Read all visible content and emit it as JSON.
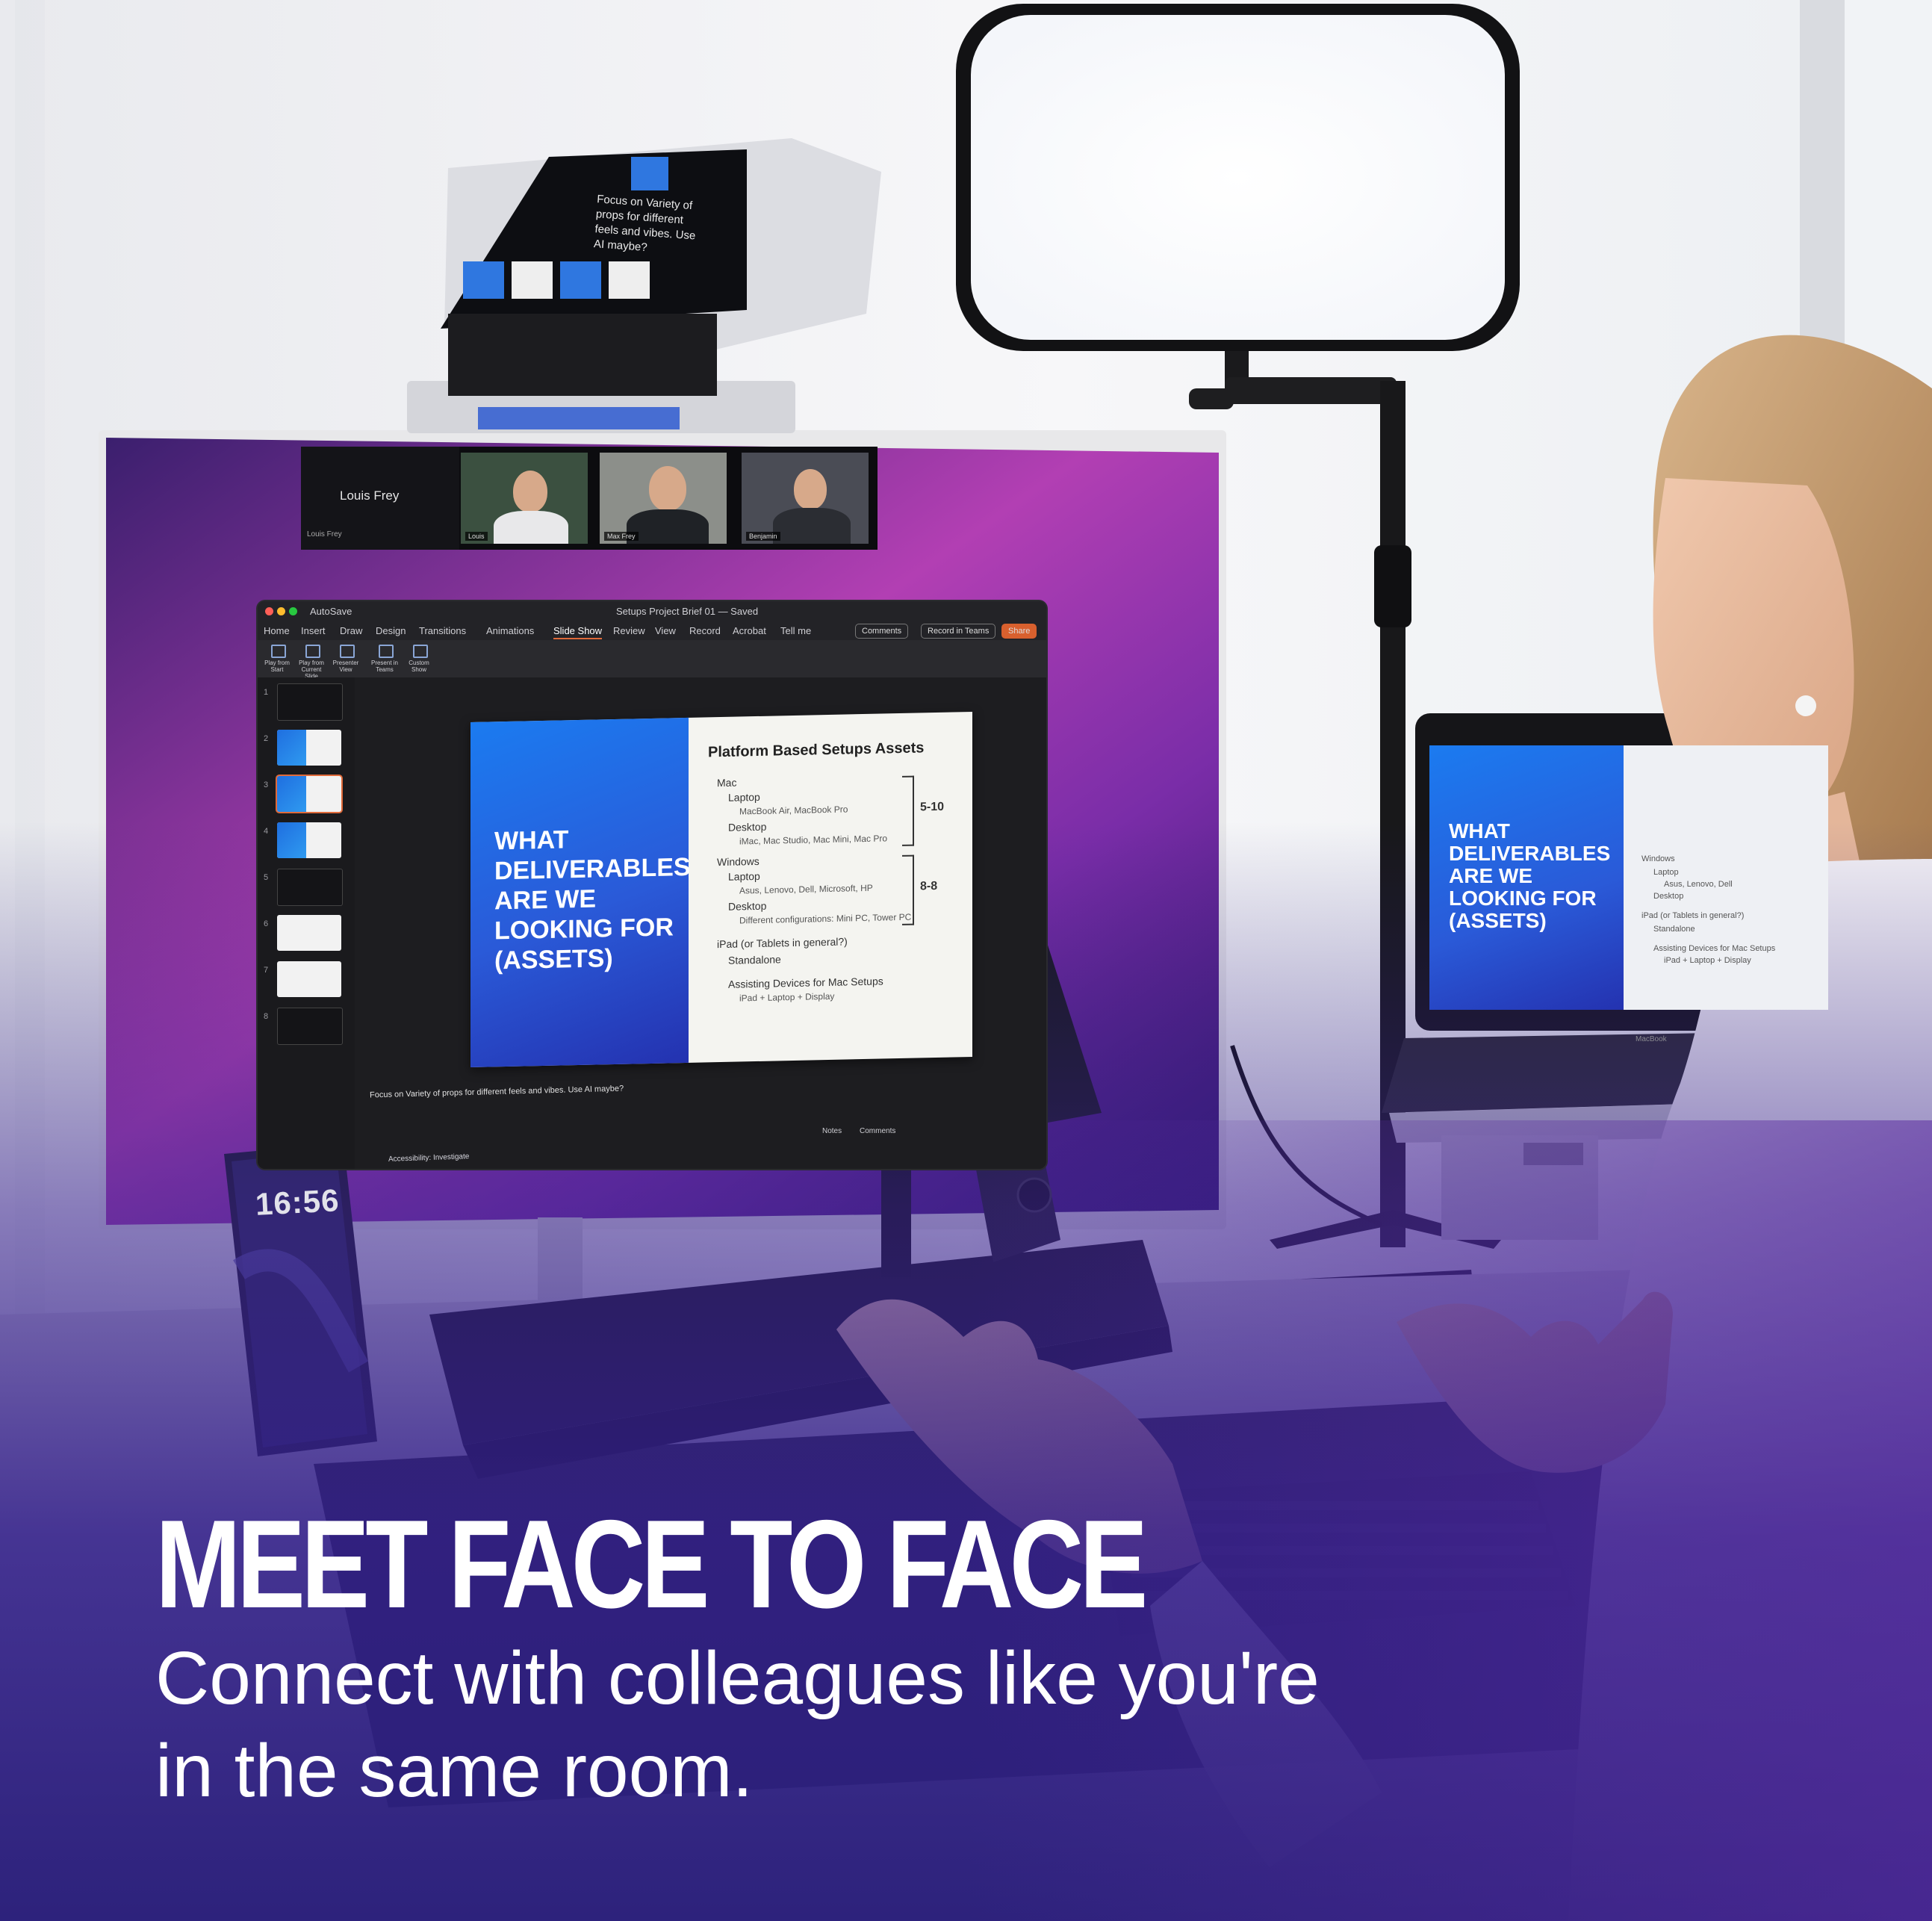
{
  "headline": {
    "title": "MEET FACE TO FACE",
    "subtitle_line1": "Connect with colleagues like you're",
    "subtitle_line2": "in the same room."
  },
  "colors": {
    "overlay_deep": "#2a1f7a",
    "overlay_purple": "#5a2aa0",
    "monitor_magenta": "#b23fb3",
    "slide_blue": "#1f6fe0"
  },
  "teleprompter": {
    "text": "Focus on Variety of props for different feels and vibes. Use AI maybe?"
  },
  "zoom_call": {
    "host_name": "Louis Frey",
    "host_sub": "Louis Frey",
    "participants": [
      "Louis",
      "Max Frey",
      "Benjamin"
    ]
  },
  "powerpoint": {
    "file_title": "Setups Project Brief 01 — Saved",
    "autosave": "AutoSave",
    "tabs": [
      "Home",
      "Insert",
      "Draw",
      "Design",
      "Transitions",
      "Animations",
      "Slide Show",
      "Review",
      "View",
      "Record",
      "Acrobat",
      "Tell me"
    ],
    "active_tab": "Slide Show",
    "buttons": {
      "comments": "Comments",
      "record": "Record in Teams",
      "share": "Share"
    },
    "ribbon": [
      "Play from Start",
      "Play from Current Slide",
      "Presenter View",
      "Present in Teams",
      "Custom Show"
    ],
    "thumb_numbers": [
      "1",
      "2",
      "3",
      "4",
      "5",
      "6",
      "7",
      "8"
    ],
    "notes": "Focus on Variety of props for different feels and vibes. Use AI maybe?",
    "status": [
      "Notes",
      "Comments"
    ],
    "accessibility": "Accessibility: Investigate"
  },
  "slide": {
    "headline": "WHAT DELIVERABLES ARE WE LOOKING FOR (ASSETS)",
    "title": "Platform Based Setups Assets",
    "items": [
      {
        "text": "Mac",
        "level": 0
      },
      {
        "text": "Laptop",
        "level": 1
      },
      {
        "text": "MacBook Air, MacBook Pro",
        "level": 2
      },
      {
        "text": "Desktop",
        "level": 1
      },
      {
        "text": "iMac, Mac Studio, Mac Mini, Mac Pro",
        "level": 2
      },
      {
        "text": "Windows",
        "level": 0
      },
      {
        "text": "Laptop",
        "level": 1
      },
      {
        "text": "Asus, Lenovo, Dell, Microsoft, HP",
        "level": 2
      },
      {
        "text": "Desktop",
        "level": 1
      },
      {
        "text": "Different configurations: Mini PC, Tower PC",
        "level": 2
      },
      {
        "text": "iPad (or Tablets in general?)",
        "level": 0
      },
      {
        "text": "Standalone",
        "level": 1
      },
      {
        "text": "Assisting Devices for Mac Setups",
        "level": 1
      },
      {
        "text": "iPad + Laptop + Display",
        "level": 2
      }
    ],
    "counts": [
      "5-10",
      "8-8"
    ]
  },
  "laptop_slide": {
    "headline": "WHAT DELIVERABLES ARE WE LOOKING FOR (ASSETS)",
    "items": [
      "Windows",
      "Laptop",
      "Asus, Lenovo, Dell",
      "Desktop",
      "iPad (or Tablets in general?)",
      "Standalone",
      "Assisting Devices for Mac Setups",
      "iPad + Laptop + Display"
    ],
    "brand": "MacBook"
  },
  "phone": {
    "time": "16:56"
  }
}
